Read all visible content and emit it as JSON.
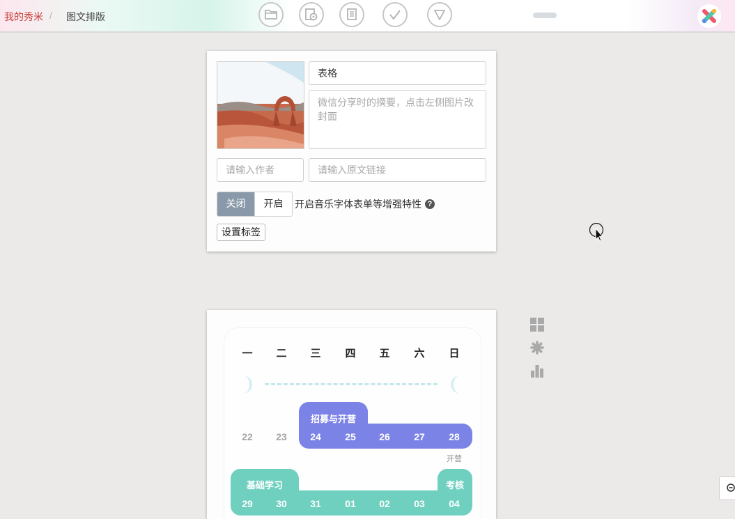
{
  "breadcrumb": {
    "home": "我的秀米",
    "separator": "/",
    "current": "图文排版"
  },
  "toolbar": {
    "icons": [
      "folder-icon",
      "preview-icon",
      "clipboard-icon",
      "check-icon",
      "triangle-down-icon"
    ]
  },
  "article": {
    "title_value": "表格",
    "summary_placeholder": "微信分享时的摘要，点击左侧图片改封面",
    "author_placeholder": "请输入作者",
    "source_link_placeholder": "请输入原文链接",
    "toggle": {
      "off_label": "关闭",
      "on_label": "开启",
      "selected": "关闭"
    },
    "feature_label": "开启音乐字体表单等增强特性",
    "help_symbol": "?",
    "tags_button": "设置标签"
  },
  "calendar": {
    "weekdays": [
      "一",
      "二",
      "三",
      "四",
      "五",
      "六",
      "日"
    ],
    "week1": {
      "days": [
        "22",
        "23",
        "24",
        "25",
        "26",
        "27",
        "28"
      ],
      "event": "招募与开营",
      "note": "开营"
    },
    "week2": {
      "days": [
        "29",
        "30",
        "31",
        "01",
        "02",
        "03",
        "04"
      ],
      "event_left": "基础学习",
      "event_right": "考核"
    }
  },
  "side_tools": [
    "grid-icon",
    "asterisk-icon",
    "bar-chart-icon"
  ],
  "colors": {
    "purple_band": "#7c83e6",
    "green_band": "#6fd0c0",
    "breadcrumb_home": "#c8403a",
    "toggle_active": "#8a99aa"
  }
}
